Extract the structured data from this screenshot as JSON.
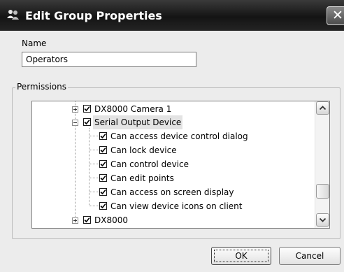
{
  "window": {
    "title": "Edit Group Properties",
    "close_icon": "close-icon"
  },
  "name_field": {
    "label": "Name",
    "value": "Operators"
  },
  "permissions": {
    "label": "Permissions",
    "tree": [
      {
        "label": "DX8000 Camera 1",
        "checked": true,
        "expander": "plus"
      },
      {
        "label": "Serial Output Device",
        "checked": true,
        "expander": "minus",
        "selected": true
      },
      {
        "label": "Can access device control dialog",
        "checked": true
      },
      {
        "label": "Can lock device",
        "checked": true
      },
      {
        "label": "Can control device",
        "checked": true
      },
      {
        "label": "Can edit points",
        "checked": true
      },
      {
        "label": "Can access on screen display",
        "checked": true
      },
      {
        "label": "Can view device icons on client",
        "checked": true
      },
      {
        "label": "DX8000",
        "checked": true,
        "expander": "plus"
      }
    ]
  },
  "buttons": {
    "ok": "OK",
    "cancel": "Cancel"
  }
}
